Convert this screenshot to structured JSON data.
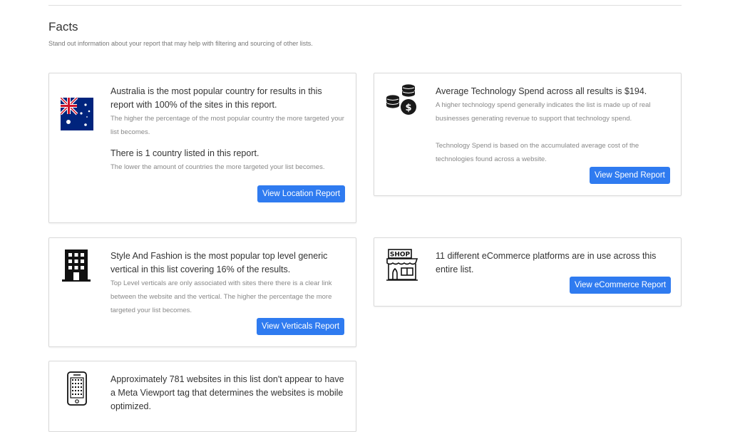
{
  "facts": {
    "title": "Facts",
    "subtitle": "Stand out information about your report that may help with filtering and sourcing of other lists."
  },
  "location": {
    "icon": "australia-flag-icon",
    "lead": "Australia is the most popular country for results in this report with 100% of the sites in this report.",
    "note": "The higher the percentage of the most popular country the more targeted your list becomes.",
    "lead2": "There is 1 country listed in this report.",
    "note2": "The lower the amount of countries the more targeted your list becomes.",
    "button": "View Location Report"
  },
  "spend": {
    "icon": "coins-dollar-icon",
    "lead": "Average Technology Spend across all results is $194.",
    "note": "A higher technology spend generally indicates the list is made up of real businesses generating revenue to support that technology spend.",
    "note2": "Technology Spend is based on the accumulated average cost of the technologies found across a website.",
    "button": "View Spend Report"
  },
  "verticals": {
    "icon": "office-building-icon",
    "lead": "Style And Fashion is the most popular top level generic vertical in this list covering 16% of the results.",
    "note": "Top Level verticals are only associated with sites there there is a clear link between the website and the vertical. The higher the percentage the more targeted your list becomes.",
    "button": "View Verticals Report"
  },
  "ecommerce": {
    "icon": "shop-icon",
    "shop_sign": "SHOP",
    "lead": "11 different eCommerce platforms are in use across this entire list.",
    "button": "View eCommerce Report"
  },
  "mobile": {
    "icon": "mobile-phone-icon",
    "lead": "Approximately 781 websites in this list don't appear to have a Meta Viewport tag that determines the websites is mobile optimized."
  },
  "colors": {
    "button_bg": "#2f7bf0",
    "flag_blue": "#00247d",
    "flag_red": "#cf142b"
  }
}
